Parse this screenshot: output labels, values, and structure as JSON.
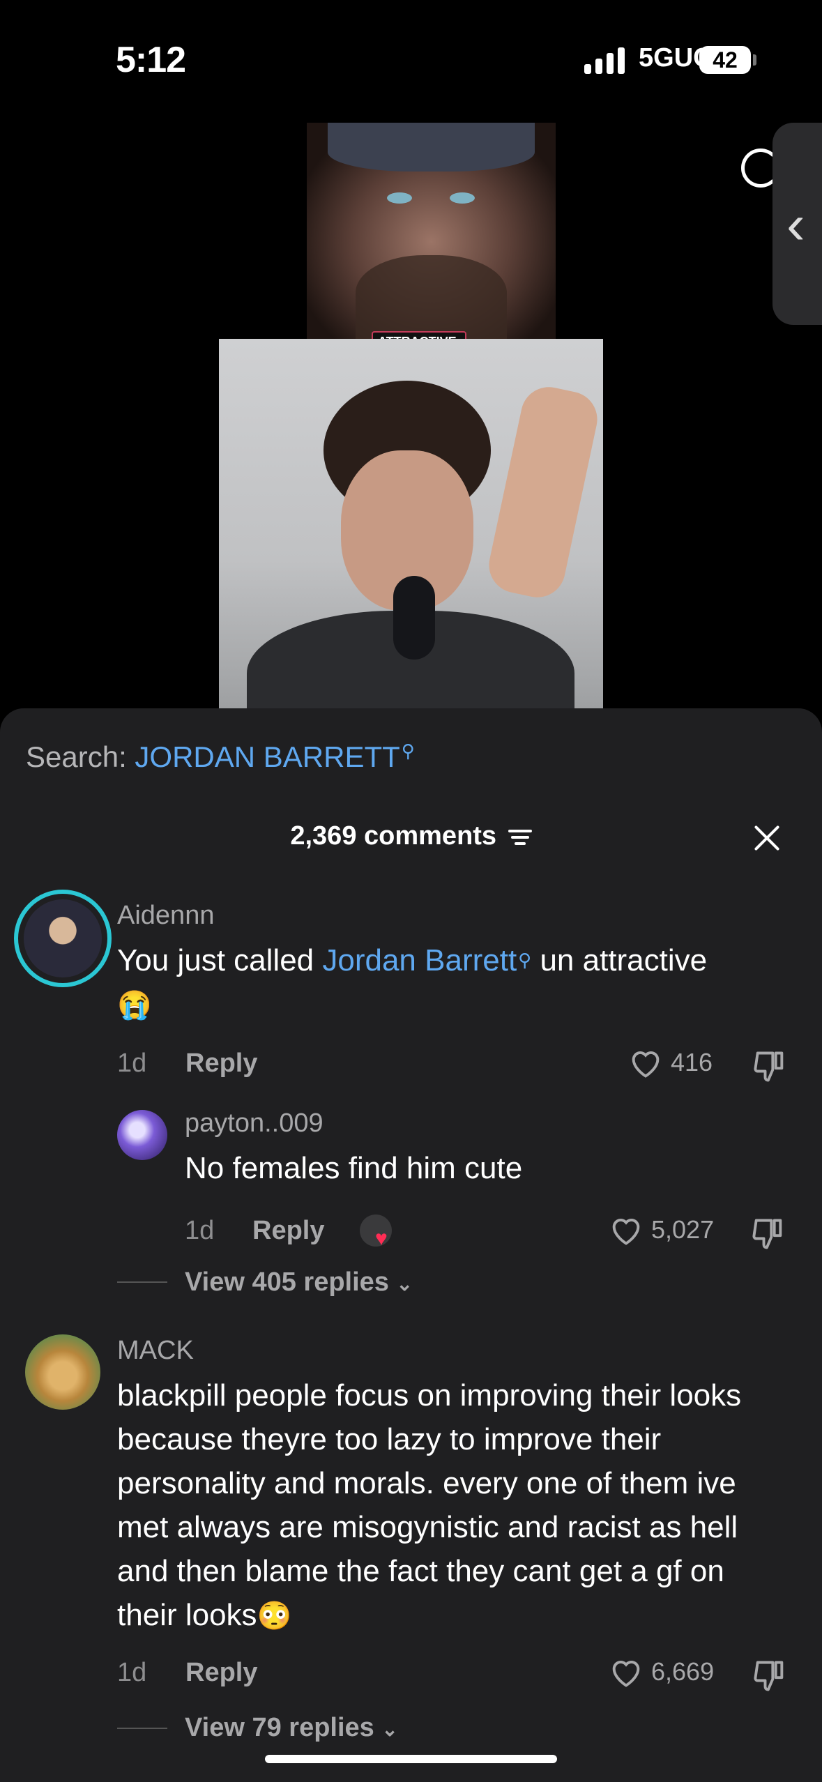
{
  "status_bar": {
    "time": "5:12",
    "network": "5GUC",
    "battery": "42"
  },
  "video": {
    "caption_label": "ATTRACTIVE."
  },
  "search": {
    "prefix": "Search:",
    "term": "JORDAN BARRETT"
  },
  "header": {
    "comments_count": "2,369 comments"
  },
  "comments": [
    {
      "user": "Aidennn",
      "text_before": "You just called ",
      "link": "Jordan Barrett",
      "text_after": " un attractive",
      "emoji": "😭",
      "age": "1d",
      "reply_label": "Reply",
      "likes": "416"
    },
    {
      "user": "payton..009",
      "text": "No females find him cute",
      "age": "1d",
      "reply_label": "Reply",
      "likes": "5,027",
      "view_replies": "View 405 replies"
    },
    {
      "user": "MACK",
      "text": "blackpill people focus on improving their looks because theyre too lazy to improve their personality and morals. every one of them ive met always are misogynistic and racist as hell and then blame the fact they cant get a gf on their looks",
      "emoji": "😳",
      "age": "1d",
      "reply_label": "Reply",
      "likes": "6,669",
      "view_replies": "View 79 replies"
    }
  ],
  "colors": {
    "sheet_bg": "#1f1f21",
    "link": "#5fa8f0",
    "muted": "#a8a8aa"
  }
}
